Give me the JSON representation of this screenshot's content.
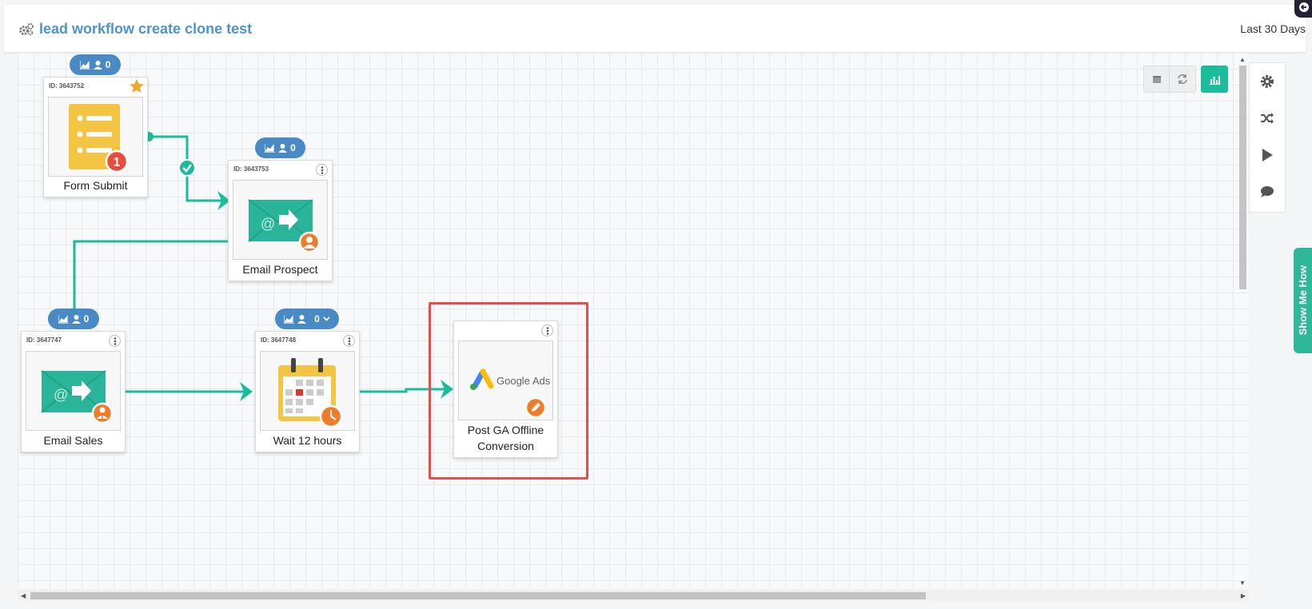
{
  "header": {
    "title": "lead workflow create clone test",
    "period": "Last 30 Days"
  },
  "colors": {
    "accent": "#1abc9c",
    "title": "#4f94c9",
    "badge": "#4a8ac4",
    "highlight": "#e84c4c",
    "orange": "#ee7c2b"
  },
  "toolbar": {
    "buttons": [
      "calendar-icon",
      "refresh-icon",
      "bar-chart-icon"
    ]
  },
  "right_panel": {
    "buttons": [
      "gear-icon",
      "shuffle-icon",
      "play-icon",
      "comment-icon"
    ]
  },
  "show_me_how": "Show Me How",
  "nodes": {
    "form_submit": {
      "id": "ID: 3643752",
      "label": "Form Submit",
      "count": "0",
      "alert": "1"
    },
    "email_prospect": {
      "id": "ID: 3643753",
      "label": "Email Prospect",
      "count": "0"
    },
    "email_sales": {
      "id": "ID: 3647747",
      "label": "Email Sales",
      "count": "0"
    },
    "wait": {
      "id": "ID: 3647748",
      "label": "Wait 12 hours",
      "count": "0"
    },
    "post_ga": {
      "label_line1": "Post GA Offline",
      "label_line2": "Conversion",
      "logo_text": "Google Ads"
    }
  }
}
